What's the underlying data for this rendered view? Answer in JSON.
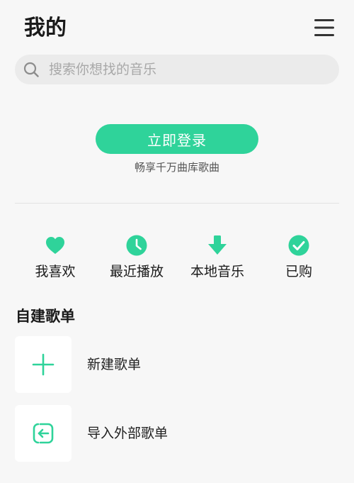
{
  "header": {
    "title": "我的",
    "menu_icon": "hamburger-menu-icon"
  },
  "search": {
    "placeholder": "搜索你想找的音乐",
    "icon": "search-icon"
  },
  "login": {
    "button_label": "立即登录",
    "subtitle": "畅享千万曲库歌曲"
  },
  "shortcuts": [
    {
      "label": "我喜欢",
      "icon": "heart-icon"
    },
    {
      "label": "最近播放",
      "icon": "clock-icon"
    },
    {
      "label": "本地音乐",
      "icon": "download-icon"
    },
    {
      "label": "已购",
      "icon": "check-circle-icon"
    }
  ],
  "playlists": {
    "section_title": "自建歌单",
    "items": [
      {
        "label": "新建歌单",
        "icon": "plus-icon"
      },
      {
        "label": "导入外部歌单",
        "icon": "import-icon"
      }
    ]
  },
  "colors": {
    "accent": "#2fd39a",
    "background": "#f7f7f7",
    "search_bg": "#ebebeb"
  }
}
